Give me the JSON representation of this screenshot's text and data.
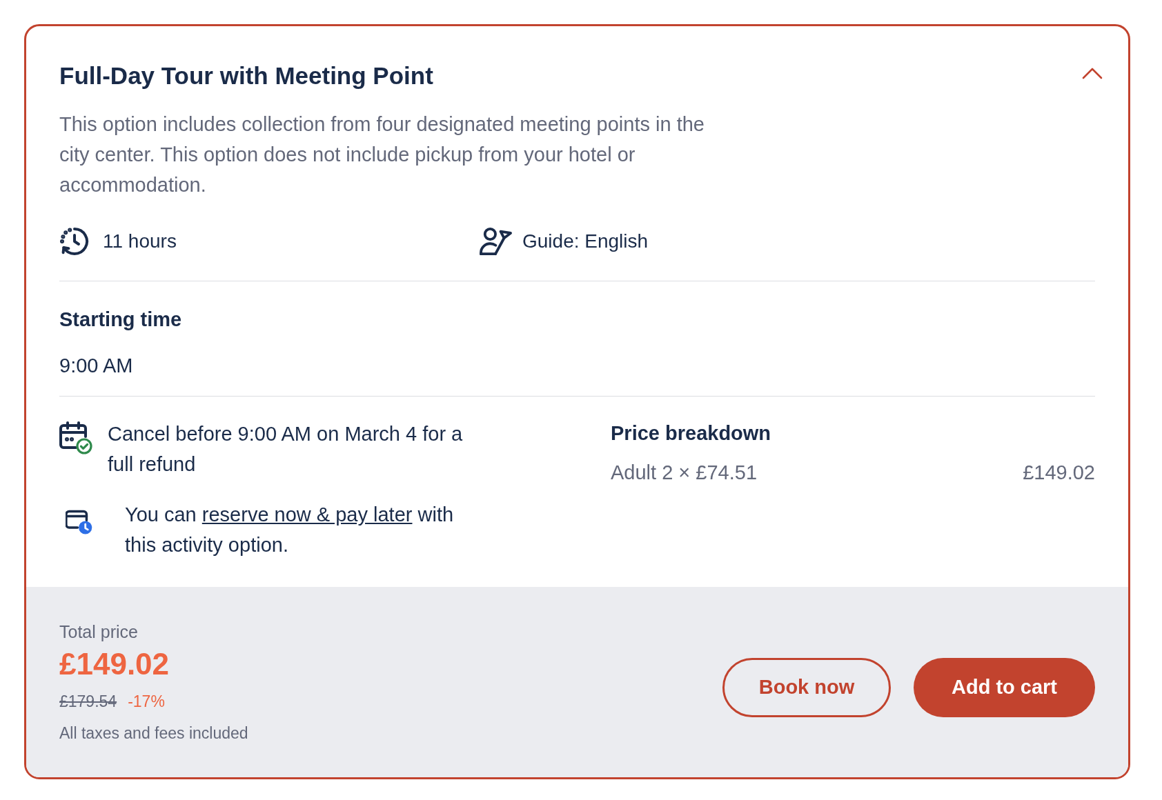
{
  "option": {
    "title": "Full-Day Tour with Meeting Point",
    "expanded": true,
    "description": "This option includes collection from four designated meeting points in the city center. This option does not include pickup from your hotel or accommodation."
  },
  "features": [
    {
      "kind": "duration",
      "text": "11 hours"
    },
    {
      "kind": "guide",
      "text": "Guide: English"
    }
  ],
  "starting_time": {
    "heading": "Starting time",
    "time": "9:00 AM"
  },
  "policies": [
    {
      "kind": "cancellation",
      "text": "Cancel before 9:00 AM on March 4 for a full refund"
    },
    {
      "kind": "reserve",
      "text_before": "You can ",
      "link": "reserve now & pay later",
      "text_after": " with this activity option."
    }
  ],
  "price_breakdown": {
    "heading": "Price breakdown",
    "rows": [
      {
        "label": "Adult 2 × £74.51",
        "amount": "£149.02"
      }
    ]
  },
  "total": {
    "label": "Total price",
    "price": "£149.02",
    "original_price": "£179.54",
    "discount": "-17%",
    "note": "All taxes and fees included"
  },
  "buttons": [
    {
      "kind": "outline",
      "label": "Book now"
    },
    {
      "kind": "filled",
      "label": "Add to cart"
    }
  ]
}
